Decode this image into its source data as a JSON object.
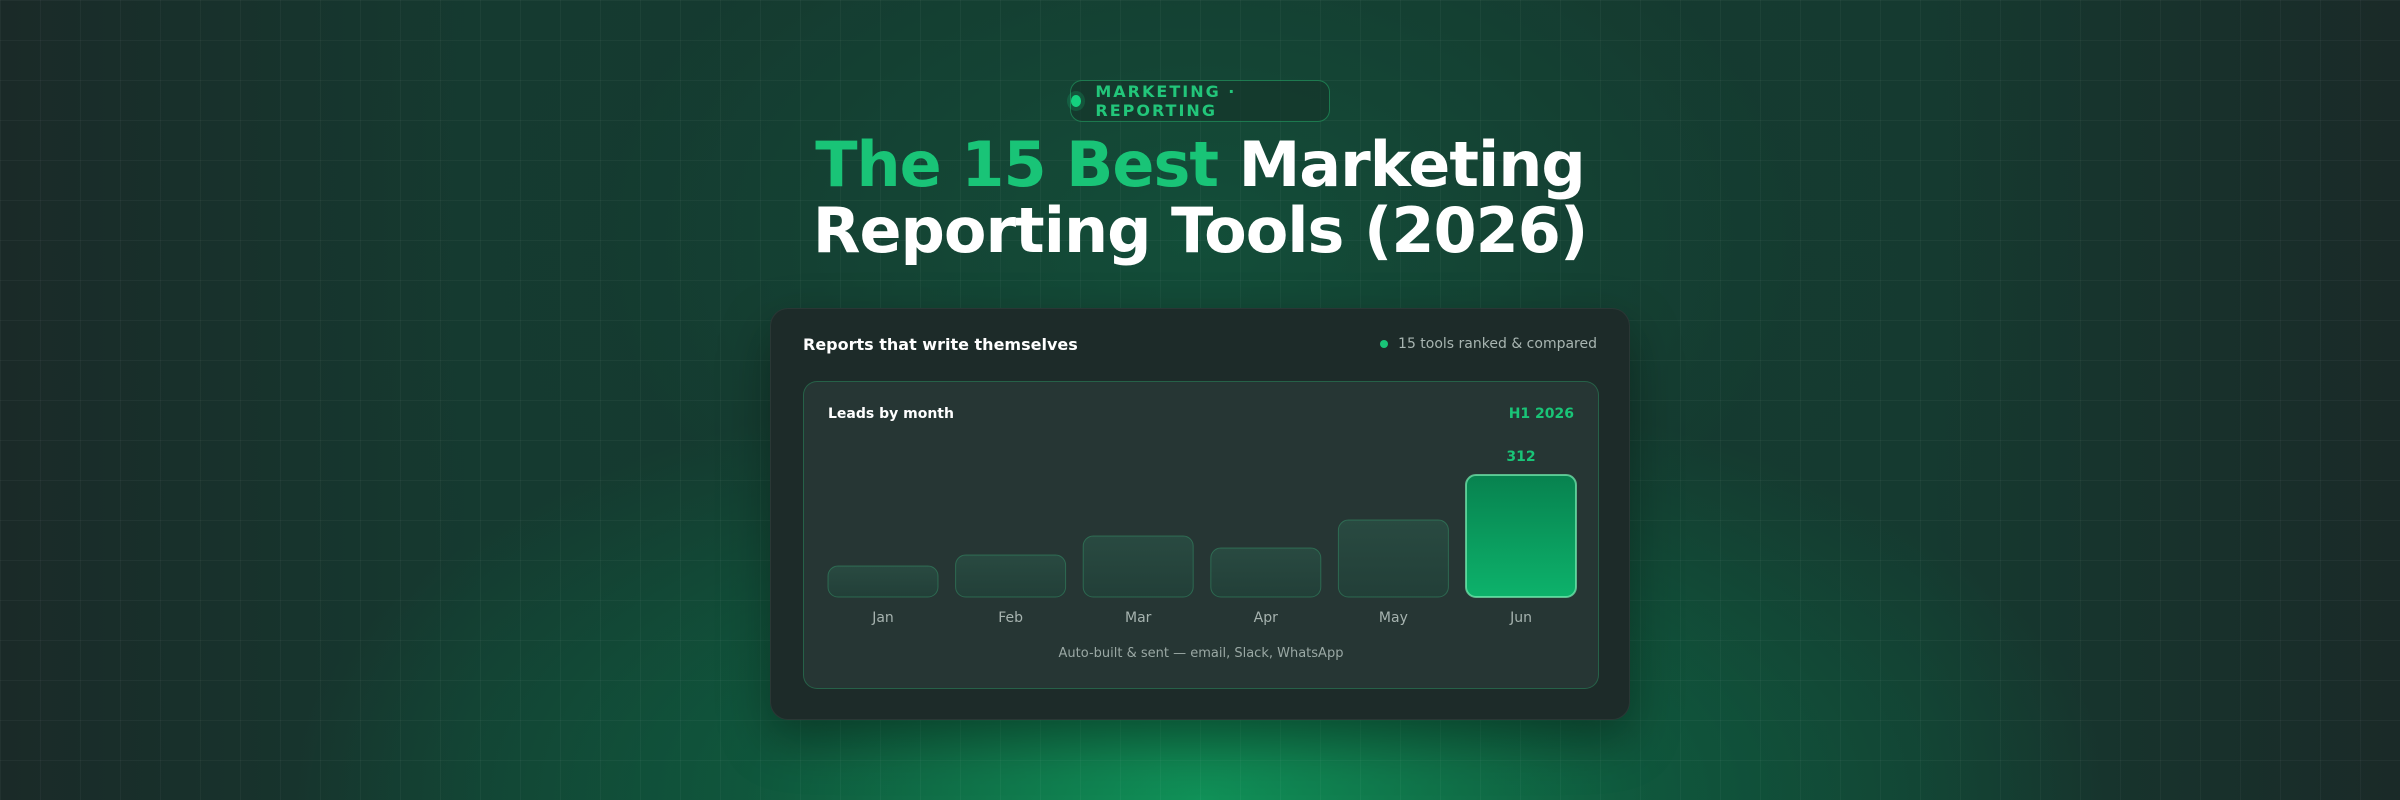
{
  "badge": {
    "label": "MARKETING · REPORTING"
  },
  "headline": {
    "accent": "The 15 Best",
    "rest_line1": "Marketing",
    "line2": "Reporting Tools (2026)"
  },
  "card": {
    "title": "Reports that write themselves",
    "meta": "15 tools ranked & compared",
    "chart": {
      "title": "Leads by month",
      "period": "H1 2026",
      "footer": "Auto-built & sent — email, Slack, WhatsApp"
    }
  },
  "chart_data": {
    "type": "bar",
    "title": "Leads by month",
    "categories": [
      "Jan",
      "Feb",
      "Mar",
      "Apr",
      "May",
      "Jun"
    ],
    "values": [
      78,
      108,
      156,
      126,
      196,
      312
    ],
    "data_labels": {
      "Jun": "312"
    },
    "highlight": "Jun",
    "ylim": [
      0,
      312
    ],
    "grid": false,
    "colors": {
      "bar": "#2a4a42",
      "highlight": "#0aa564",
      "label": "#19c477"
    }
  }
}
